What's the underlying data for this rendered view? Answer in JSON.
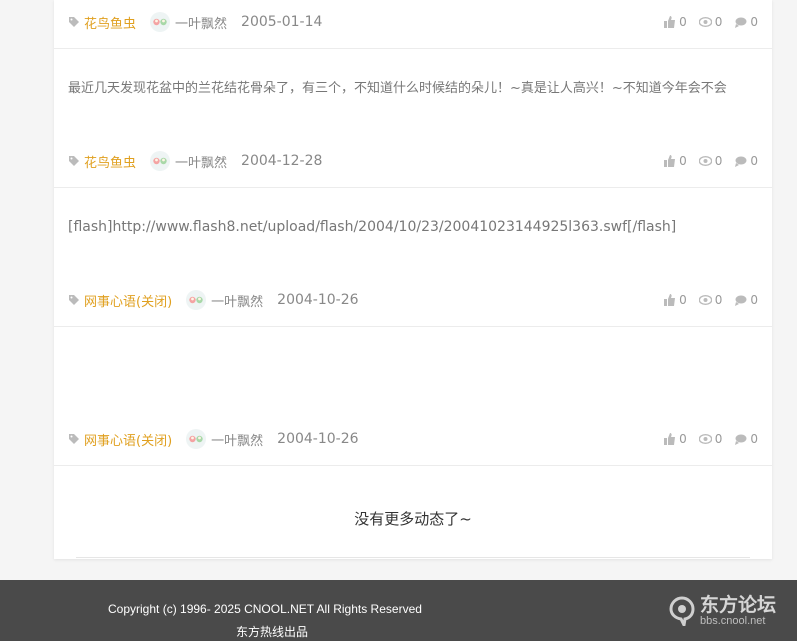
{
  "posts": [
    {
      "content": "",
      "tag": "花鸟鱼虫",
      "author": "一叶飘然",
      "date": "2005-01-14",
      "likes": "0",
      "views": "0",
      "comments": "0"
    },
    {
      "content": "最近几天发现花盆中的兰花结花骨朵了，有三个，不知道什么时候结的朵儿！~真是让人高兴！~不知道今年会不会",
      "tag": "花鸟鱼虫",
      "author": "一叶飘然",
      "date": "2004-12-28",
      "likes": "0",
      "views": "0",
      "comments": "0"
    },
    {
      "content": "[flash]http://www.flash8.net/upload/flash/2004/10/23/20041023144925l363.swf[/flash]",
      "tag": "网事心语(关闭)",
      "author": "一叶飘然",
      "date": "2004-10-26",
      "likes": "0",
      "views": "0",
      "comments": "0"
    },
    {
      "content": "",
      "tag": "网事心语(关闭)",
      "author": "一叶飘然",
      "date": "2004-10-26",
      "likes": "0",
      "views": "0",
      "comments": "0"
    }
  ],
  "no_more_text": "没有更多动态了~",
  "footer": {
    "copyright": "Copyright (c) 1996- 2025 CNOOL.NET All Rights Reserved",
    "produced_by": "东方热线出品",
    "logo_name": "东方论坛",
    "logo_domain": "bbs.cnool.net"
  },
  "colors": {
    "tag": "#e0a020",
    "footer_bg": "#4a4a4a",
    "page_bg": "#f5f5f5"
  },
  "icons": [
    "tag-icon",
    "avatar",
    "thumbs-up-icon",
    "eye-icon",
    "comment-icon",
    "cnool-logo-icon"
  ]
}
